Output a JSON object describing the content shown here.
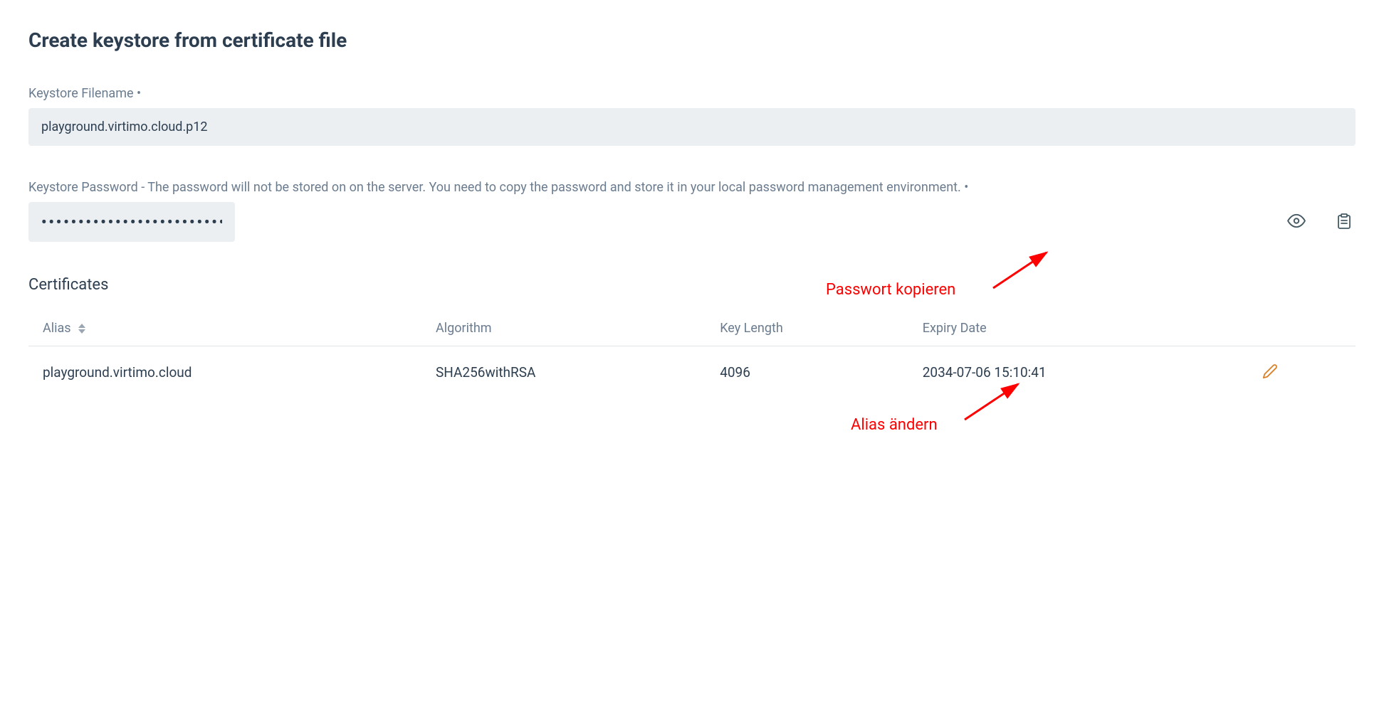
{
  "title": "Create keystore from certificate file",
  "filename": {
    "label": "Keystore Filename •",
    "value": "playground.virtimo.cloud.p12"
  },
  "password": {
    "label": "Keystore Password - The password will not be stored on on the server. You need to copy the password and store it in your local password management environment. •",
    "value": "••••••••••••••••••••••••••••••••••••••••••••"
  },
  "certificates": {
    "title": "Certificates",
    "headers": {
      "alias": "Alias",
      "algorithm": "Algorithm",
      "keylength": "Key Length",
      "expiry": "Expiry Date"
    },
    "rows": [
      {
        "alias": "playground.virtimo.cloud",
        "algorithm": "SHA256withRSA",
        "keylength": "4096",
        "expiry": "2034-07-06 15:10:41"
      }
    ]
  },
  "annotations": {
    "copy": "Passwort kopieren",
    "edit": "Alias ändern"
  }
}
